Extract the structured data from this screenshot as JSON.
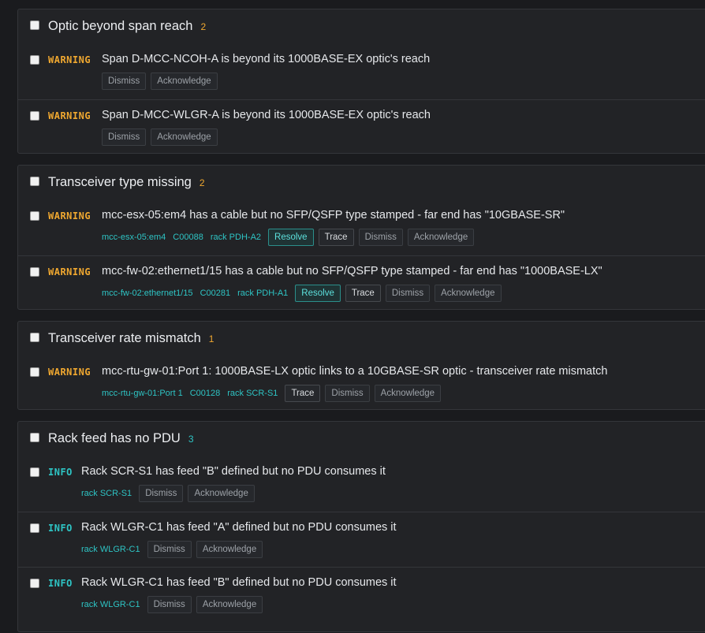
{
  "groups": [
    {
      "title": "Optic beyond span reach",
      "count": "2",
      "items": [
        {
          "severity": "WARNING",
          "message": "Span D-MCC-NCOH-A is beyond its 1000BASE-EX optic's reach",
          "dismiss": "Dismiss",
          "acknowledge": "Acknowledge"
        },
        {
          "severity": "WARNING",
          "message": "Span D-MCC-WLGR-A is beyond its 1000BASE-EX optic's reach",
          "dismiss": "Dismiss",
          "acknowledge": "Acknowledge"
        }
      ]
    },
    {
      "title": "Transceiver type missing",
      "count": "2",
      "items": [
        {
          "severity": "WARNING",
          "message": "mcc-esx-05:em4 has a cable but no SFP/QSFP type stamped - far end has \"10GBASE-SR\"",
          "links": [
            "mcc-esx-05:em4",
            "C00088",
            "rack PDH-A2"
          ],
          "resolve": "Resolve",
          "trace": "Trace",
          "dismiss": "Dismiss",
          "acknowledge": "Acknowledge"
        },
        {
          "severity": "WARNING",
          "message": "mcc-fw-02:ethernet1/15 has a cable but no SFP/QSFP type stamped - far end has \"1000BASE-LX\"",
          "links": [
            "mcc-fw-02:ethernet1/15",
            "C00281",
            "rack PDH-A1"
          ],
          "resolve": "Resolve",
          "trace": "Trace",
          "dismiss": "Dismiss",
          "acknowledge": "Acknowledge"
        }
      ]
    },
    {
      "title": "Transceiver rate mismatch",
      "count": "1",
      "items": [
        {
          "severity": "WARNING",
          "message": "mcc-rtu-gw-01:Port 1: 1000BASE-LX optic links to a 10GBASE-SR optic - transceiver rate mismatch",
          "links": [
            "mcc-rtu-gw-01:Port 1",
            "C00128",
            "rack SCR-S1"
          ],
          "trace": "Trace",
          "dismiss": "Dismiss",
          "acknowledge": "Acknowledge"
        }
      ]
    },
    {
      "title": "Rack feed has no PDU",
      "count": "3",
      "items": [
        {
          "severity": "INFO",
          "message": "Rack SCR-S1 has feed \"B\" defined but no PDU consumes it",
          "links": [
            "rack SCR-S1"
          ],
          "dismiss": "Dismiss",
          "acknowledge": "Acknowledge"
        },
        {
          "severity": "INFO",
          "message": "Rack WLGR-C1 has feed \"A\" defined but no PDU consumes it",
          "links": [
            "rack WLGR-C1"
          ],
          "dismiss": "Dismiss",
          "acknowledge": "Acknowledge"
        },
        {
          "severity": "INFO",
          "message": "Rack WLGR-C1 has feed \"B\" defined but no PDU consumes it",
          "links": [
            "rack WLGR-C1"
          ],
          "dismiss": "Dismiss",
          "acknowledge": "Acknowledge"
        }
      ]
    }
  ],
  "colors": {
    "warning": "#f0a830",
    "info": "#2ec4c4",
    "background": "#1a1b1e",
    "panel": "#222326"
  }
}
